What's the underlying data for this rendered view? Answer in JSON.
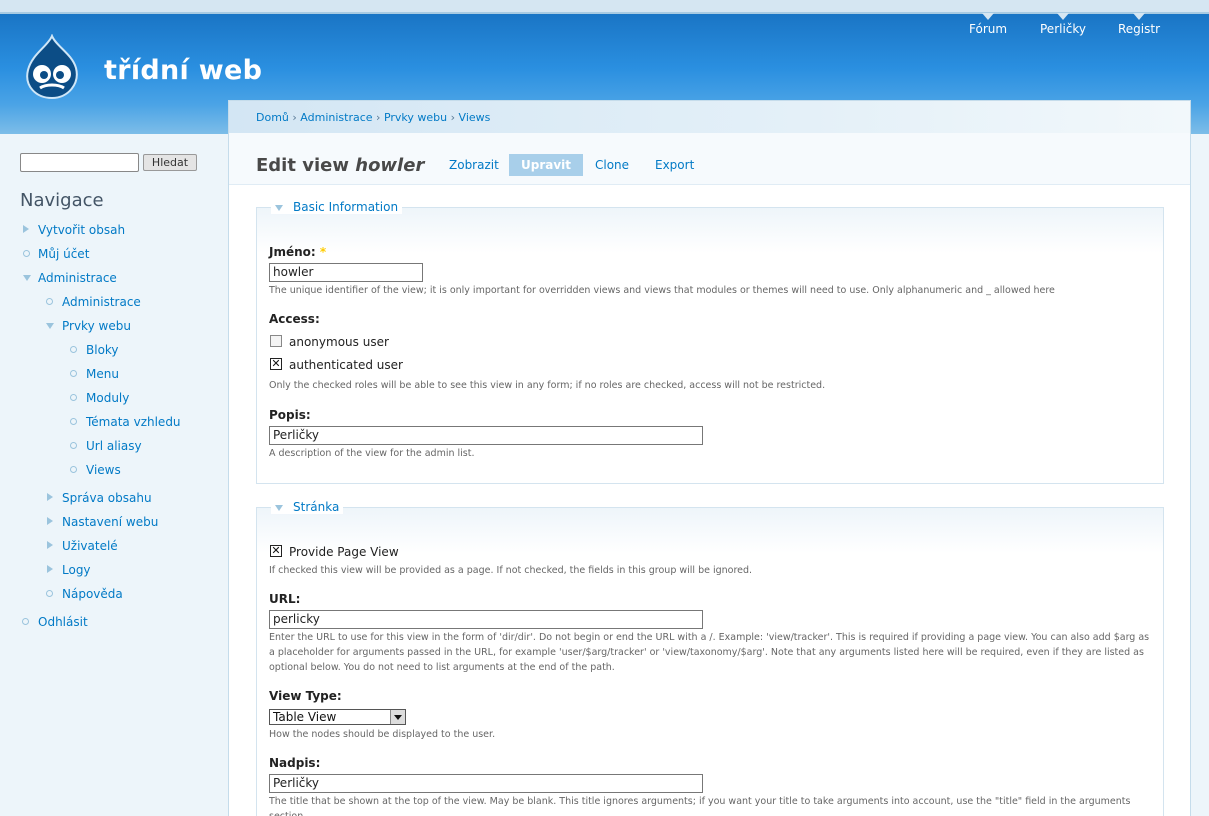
{
  "site": {
    "name": "třídní web",
    "logo_icon": "drupal-drop-icon",
    "primary_links": [
      "Fórum",
      "Perličky",
      "Registr"
    ]
  },
  "search": {
    "value": "",
    "button_label": "Hledat"
  },
  "navigation": {
    "title": "Navigace",
    "items": [
      {
        "label": "Vytvořit obsah",
        "state": "collapsed"
      },
      {
        "label": "Můj účet",
        "state": "leaf"
      },
      {
        "label": "Administrace",
        "state": "expanded"
      },
      {
        "label": "Administrace",
        "state": "leaf"
      },
      {
        "label": "Prvky webu",
        "state": "expanded"
      },
      {
        "label": "Bloky",
        "state": "leaf"
      },
      {
        "label": "Menu",
        "state": "leaf"
      },
      {
        "label": "Moduly",
        "state": "leaf"
      },
      {
        "label": "Témata vzhledu",
        "state": "leaf"
      },
      {
        "label": "Url aliasy",
        "state": "leaf"
      },
      {
        "label": "Views",
        "state": "leaf"
      },
      {
        "label": "Správa obsahu",
        "state": "collapsed"
      },
      {
        "label": "Nastavení webu",
        "state": "collapsed"
      },
      {
        "label": "Uživatelé",
        "state": "collapsed"
      },
      {
        "label": "Logy",
        "state": "collapsed"
      },
      {
        "label": "Nápověda",
        "state": "leaf"
      },
      {
        "label": "Odhlásit",
        "state": "leaf"
      }
    ]
  },
  "breadcrumb": [
    "Domů",
    "Administrace",
    "Prvky webu",
    "Views"
  ],
  "breadcrumb_separator": "›",
  "page": {
    "title_prefix": "Edit view",
    "title_name": "howler",
    "tabs": [
      {
        "label": "Zobrazit",
        "active": false
      },
      {
        "label": "Upravit",
        "active": true
      },
      {
        "label": "Clone",
        "active": false
      },
      {
        "label": "Export",
        "active": false
      }
    ]
  },
  "basic_info": {
    "legend": "Basic Information",
    "name_label": "Jméno:",
    "required_mark": "*",
    "name_value": "howler",
    "name_desc": "The unique identifier of the view; it is only important for overridden views and views that modules or themes will need to use. Only alphanumeric and _ allowed here",
    "access_label": "Access:",
    "roles": [
      {
        "label": "anonymous user",
        "checked": false
      },
      {
        "label": "authenticated user",
        "checked": true
      }
    ],
    "access_desc": "Only the checked roles will be able to see this view in any form; if no roles are checked, access will not be restricted.",
    "popis_label": "Popis:",
    "popis_value": "Perličky",
    "popis_desc": "A description of the view for the admin list."
  },
  "page_section": {
    "legend": "Stránka",
    "provide_label": "Provide Page View",
    "provide_checked": true,
    "provide_desc": "If checked this view will be provided as a page. If not checked, the fields in this group will be ignored.",
    "url_label": "URL:",
    "url_value": "perlicky",
    "url_desc": "Enter the URL to use for this view in the form of 'dir/dir'. Do not begin or end the URL with a /. Example: 'view/tracker'. This is required if providing a page view. You can also add $arg as a placeholder for arguments passed in the URL, for example 'user/$arg/tracker' or 'view/taxonomy/$arg'. Note that any arguments listed here will be required, even if they are listed as optional below. You do not need to list arguments at the end of the path.",
    "type_label": "View Type:",
    "type_value": "Table View",
    "type_desc": "How the nodes should be displayed to the user.",
    "nadpis_label": "Nadpis:",
    "nadpis_value": "Perličky",
    "nadpis_desc": "The title that be shown at the top of the view. May be blank. This title ignores arguments; if you want your title to take arguments into account, use the \"title\" field in the arguments section."
  }
}
